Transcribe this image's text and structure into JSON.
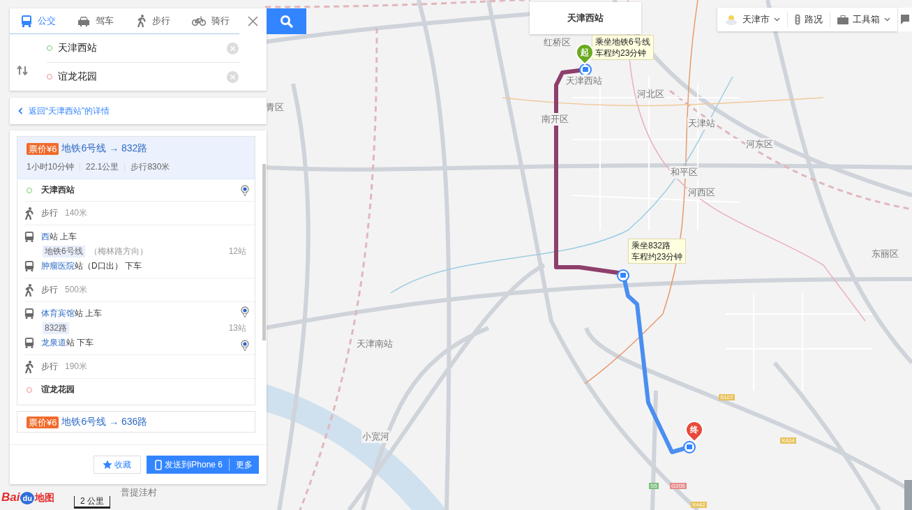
{
  "mode_tabs": [
    {
      "kind": "bus",
      "label": "公交",
      "selected": true
    },
    {
      "kind": "car",
      "label": "驾车",
      "selected": false
    },
    {
      "kind": "walk",
      "label": "步行",
      "selected": false
    },
    {
      "kind": "bike",
      "label": "骑行",
      "selected": false
    }
  ],
  "start": {
    "value": "天津西站"
  },
  "end": {
    "value": "谊龙花园"
  },
  "back_link": "返回“天津西站”的详情",
  "routes": [
    {
      "price": "票价¥6",
      "title": "地铁6号线 → 832路",
      "duration": "1小时10分钟",
      "distance": "22.1公里",
      "walk": "步行830米",
      "expanded": true,
      "steps": [
        {
          "kind": "start",
          "name": "天津西站",
          "pin": true
        },
        {
          "kind": "walk",
          "label": "步行",
          "distance": "140米"
        },
        {
          "kind": "board",
          "station": "西",
          "suffix": "站",
          "action": "上车",
          "pin": false
        },
        {
          "kind": "line",
          "line": "地铁6号线",
          "direction": "（梅林路方向）",
          "stops": "12站"
        },
        {
          "kind": "alight",
          "station": "肿瘤医院",
          "suffix": "站（D口出）",
          "action": "下车",
          "pin": false
        },
        {
          "kind": "walk",
          "label": "步行",
          "distance": "500米"
        },
        {
          "kind": "board",
          "station": "体育宾馆",
          "suffix": "站",
          "action": "上车",
          "pin": true
        },
        {
          "kind": "line",
          "line": "832路",
          "stops": "13站"
        },
        {
          "kind": "alight",
          "station": "龙泉道",
          "suffix": "站",
          "action": "下车",
          "pin": true
        },
        {
          "kind": "walk",
          "label": "步行",
          "distance": "190米"
        },
        {
          "kind": "end",
          "name": "谊龙花园"
        }
      ]
    },
    {
      "price": "票价¥6",
      "title": "地铁6号线 → 636路",
      "expanded": false
    }
  ],
  "actions": {
    "favorite": "收藏",
    "send": "发送到iPhone 6",
    "more": "更多"
  },
  "map": {
    "popup": "天津西站",
    "toolbar": {
      "city": "天津市",
      "traffic": "路况",
      "toolbox": "工具箱"
    },
    "callouts": [
      {
        "line1": "乘坐地铁6号线",
        "line2": "车程约23分钟"
      },
      {
        "line1": "乘坐832路",
        "line2": "车程约23分钟"
      }
    ],
    "start_marker": "起",
    "end_marker": "终",
    "places": [
      "红桥区",
      "天津西站",
      "河北区",
      "青区",
      "南开区",
      "天津站",
      "河东区",
      "和平区",
      "河西区",
      "东丽区",
      "天津南站",
      "小宽河",
      "普提洼村"
    ],
    "shields": [
      "S107",
      "X424",
      "S5",
      "G205",
      "X442"
    ],
    "scale": "2 公里",
    "logo": {
      "part1": "Bai",
      "part2": "du",
      "part3": "地图"
    }
  }
}
